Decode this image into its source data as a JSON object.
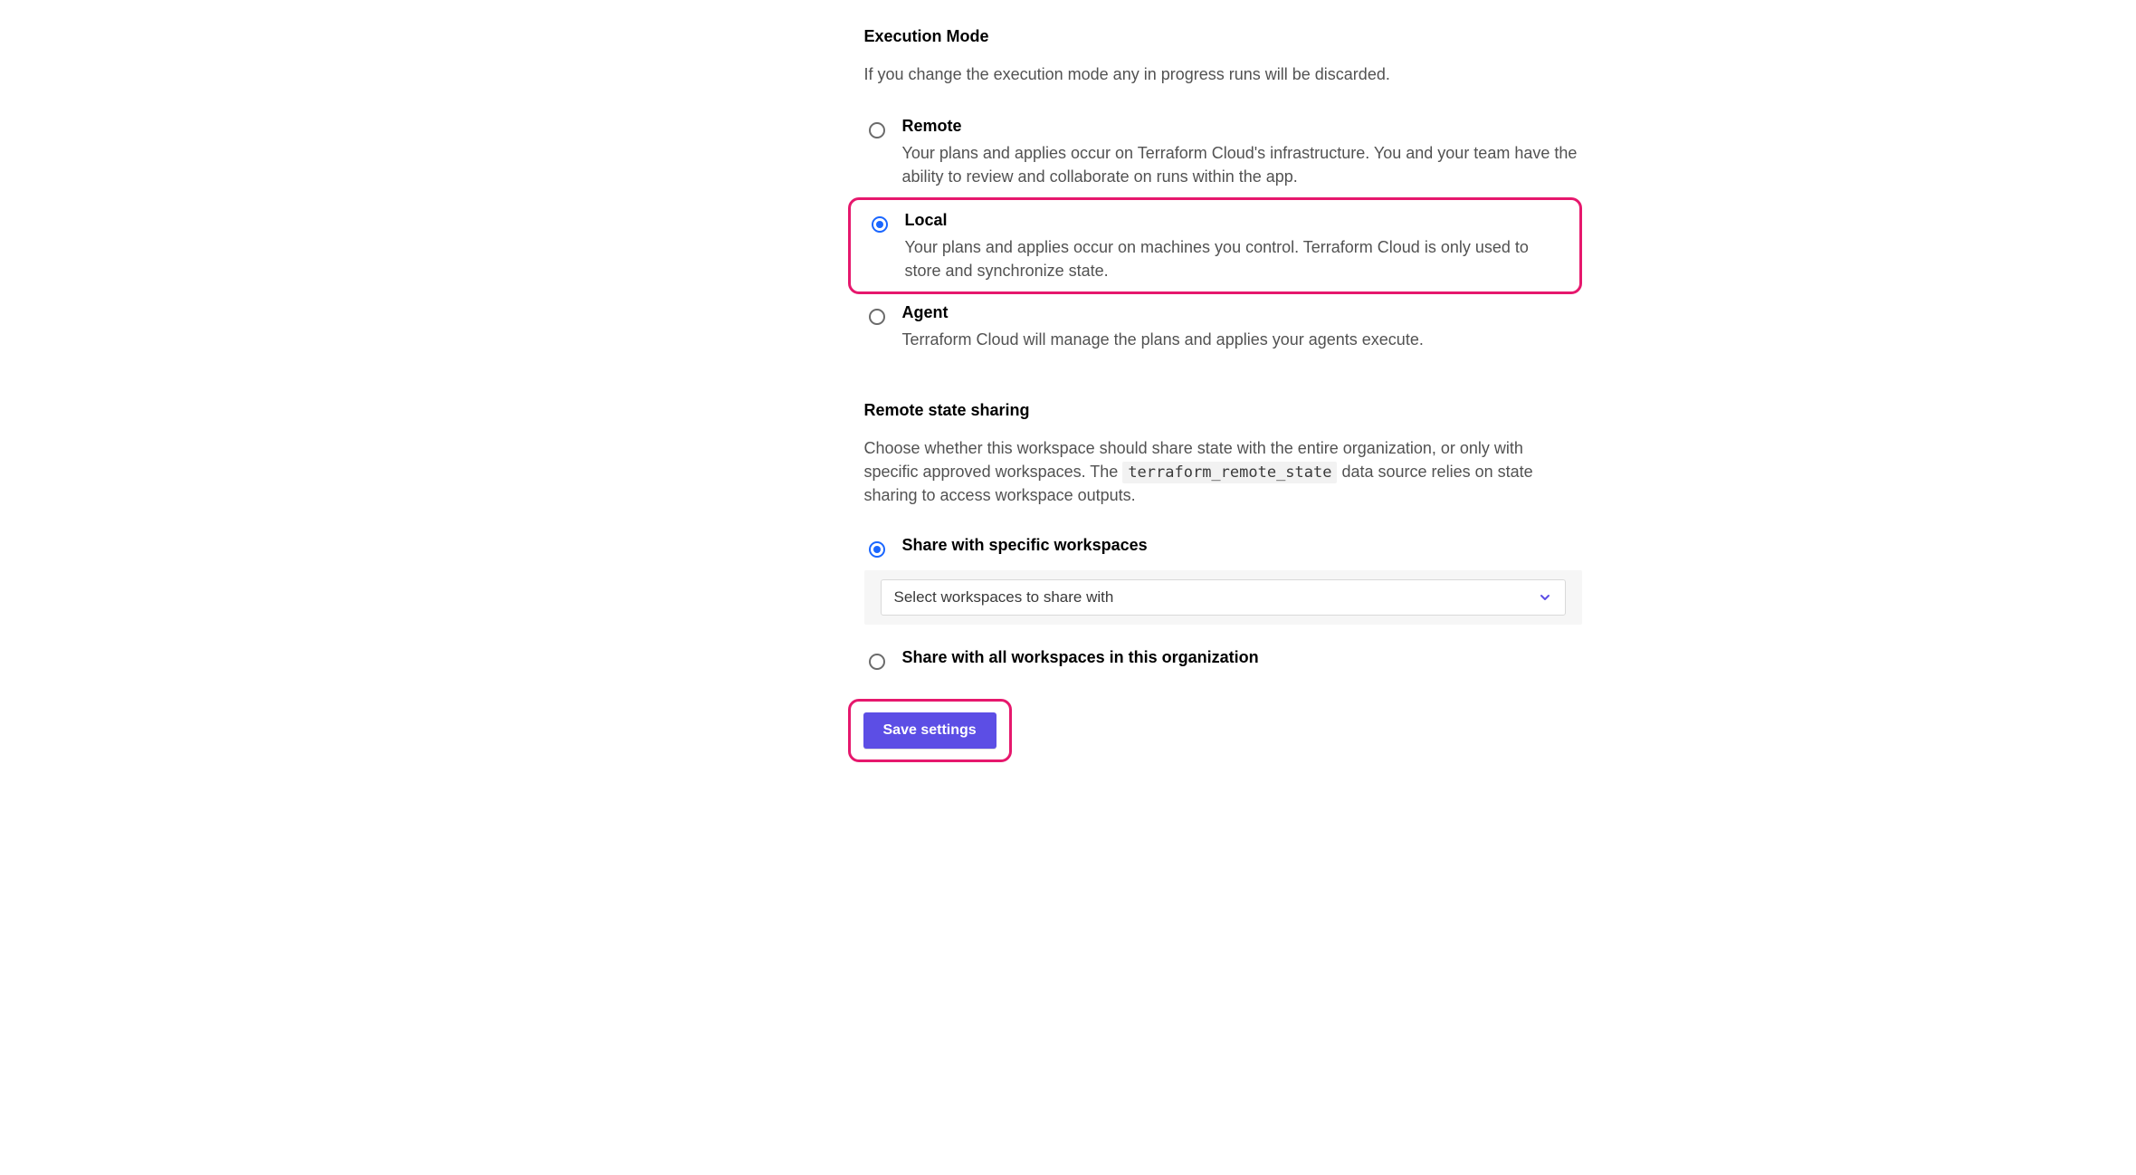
{
  "execution_mode": {
    "heading": "Execution Mode",
    "description": "If you change the execution mode any in progress runs will be discarded.",
    "options": {
      "remote": {
        "label": "Remote",
        "help": "Your plans and applies occur on Terraform Cloud's infrastructure. You and your team have the ability to review and collaborate on runs within the app."
      },
      "local": {
        "label": "Local",
        "help": "Your plans and applies occur on machines you control. Terraform Cloud is only used to store and synchronize state."
      },
      "agent": {
        "label": "Agent",
        "help": "Terraform Cloud will manage the plans and applies your agents execute."
      }
    }
  },
  "remote_state": {
    "heading": "Remote state sharing",
    "desc_pre": "Choose whether this workspace should share state with the entire organization, or only with specific approved workspaces. The ",
    "desc_code": "terraform_remote_state",
    "desc_post": " data source relies on state sharing to access workspace outputs.",
    "options": {
      "specific": {
        "label": "Share with specific workspaces"
      },
      "all": {
        "label": "Share with all workspaces in this organization"
      }
    },
    "dropdown_placeholder": "Select workspaces to share with"
  },
  "actions": {
    "save": "Save settings"
  }
}
